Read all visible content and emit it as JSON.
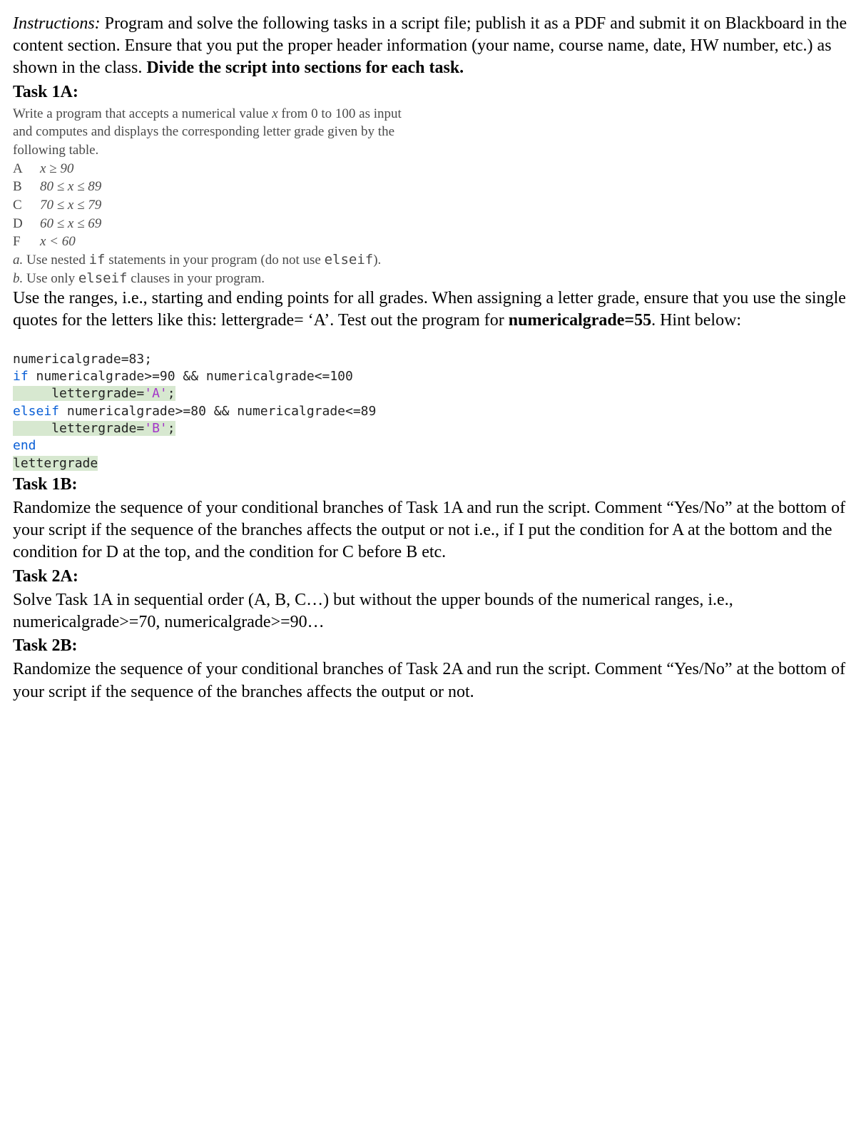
{
  "instructions": {
    "label": "Instructions:",
    "body_plain": " Program and solve the following tasks in a script file; publish it as a PDF and submit it on Blackboard in the content section. Ensure that you put the proper header information (your name, course name, date, HW number, etc.) as shown in the class. ",
    "body_bold": "Divide the script into sections for each task."
  },
  "task1a": {
    "title": "Task 1A:",
    "intro1": "Write a program that accepts a numerical value ",
    "intro_var": "x",
    "intro2": " from 0 to 100 as input",
    "intro3": "and computes and displays the corresponding letter grade given by the",
    "intro4": "following table.",
    "grades": [
      {
        "letter": "A",
        "cond": "x ≥ 90"
      },
      {
        "letter": "B",
        "cond": "80 ≤ x ≤ 89"
      },
      {
        "letter": "C",
        "cond": "70 ≤ x ≤ 79"
      },
      {
        "letter": "D",
        "cond": "60 ≤ x ≤ 69"
      },
      {
        "letter": "F",
        "cond": "x < 60"
      }
    ],
    "sub_a_label": "a.",
    "sub_a_1": "Use nested ",
    "sub_a_code1": "if",
    "sub_a_2": " statements in your program (do not use ",
    "sub_a_code2": "elseif",
    "sub_a_3": ").",
    "sub_b_label": "b.",
    "sub_b_1": "Use only ",
    "sub_b_code": "elseif",
    "sub_b_2": " clauses in your program.",
    "para_1": "Use the ranges, i.e., starting and ending points for all grades. When assigning a letter grade, ensure that you use the single quotes for the letters like this: lettergrade= ‘A’. Test out the program for ",
    "para_bold": "numericalgrade=55",
    "para_2": ". Hint below:",
    "code": {
      "l1": "numericalgrade=83;",
      "l2a": "if",
      "l2b": " numericalgrade>=90 && numericalgrade<=100",
      "l3a": "     lettergrade=",
      "l3b": "'A'",
      "l3c": ";",
      "l4a": "elseif",
      "l4b": " numericalgrade>=80 && numericalgrade<=89",
      "l5a": "     lettergrade=",
      "l5b": "'B'",
      "l5c": ";",
      "l6": "end",
      "l7": "lettergrade"
    }
  },
  "task1b": {
    "title": "Task 1B:",
    "body": "Randomize the sequence of your conditional branches of Task 1A and run the script. Comment “Yes/No” at the bottom of your script if the sequence of the branches affects the output or not i.e., if I put the condition for A at the bottom and the condition for D at the top, and the condition for C before B etc."
  },
  "task2a": {
    "title": "Task 2A:",
    "body": "Solve Task 1A in sequential order (A, B, C…) but without the upper bounds of the numerical ranges, i.e., numericalgrade>=70, numericalgrade>=90…"
  },
  "task2b": {
    "title": "Task 2B:",
    "body": "Randomize the sequence of your conditional branches of Task 2A and run the script. Comment “Yes/No” at the bottom of your script if the sequence of the branches affects the output or not."
  }
}
